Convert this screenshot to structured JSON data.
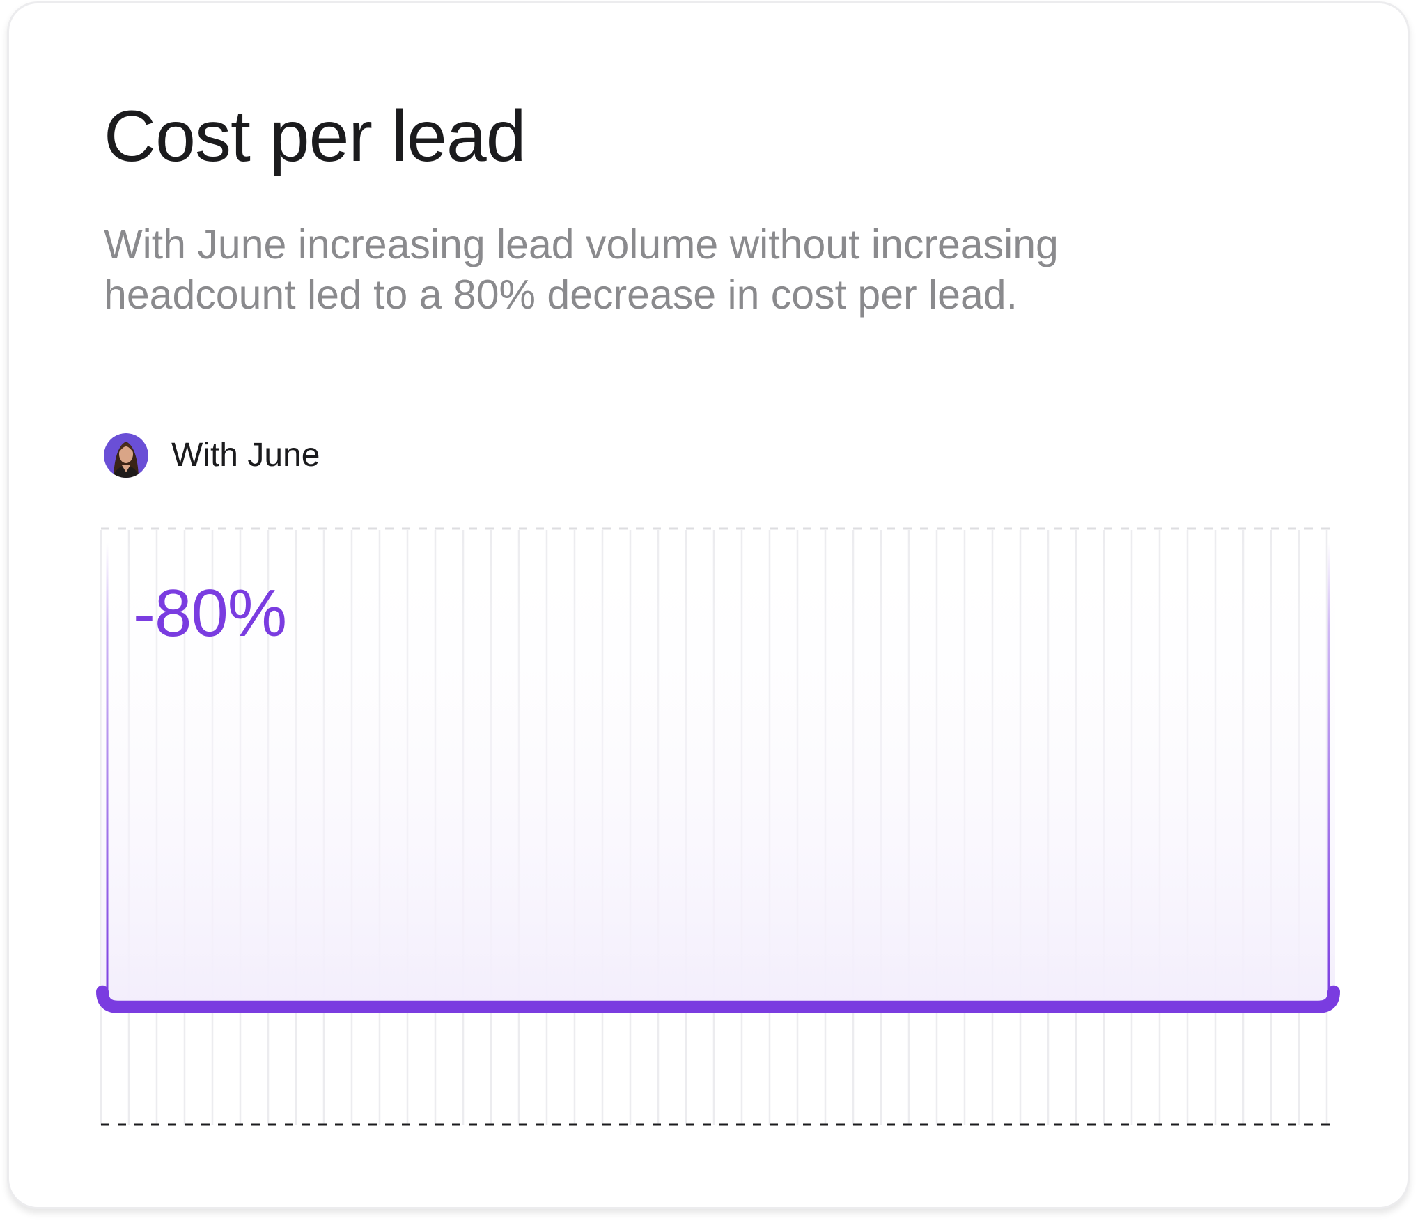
{
  "card": {
    "title": "Cost per lead",
    "description": "With June increasing lead volume without increasing headcount led to a 80% decrease in cost per lead."
  },
  "legend": {
    "label": "With June",
    "avatar_icon": "avatar-portrait-icon"
  },
  "colors": {
    "accent": "#7a3ce0",
    "title": "#1b1b1d",
    "description": "#8a8a8d",
    "gridline": "#ececef"
  },
  "chart_data": {
    "type": "bar",
    "title": "Cost per lead",
    "categories": [
      "With June"
    ],
    "series": [
      {
        "name": "With June",
        "values": [
          20
        ]
      }
    ],
    "ylim": [
      0,
      100
    ],
    "annotations": [
      "-80%"
    ],
    "grid": true,
    "legend_placement": "top-left"
  }
}
